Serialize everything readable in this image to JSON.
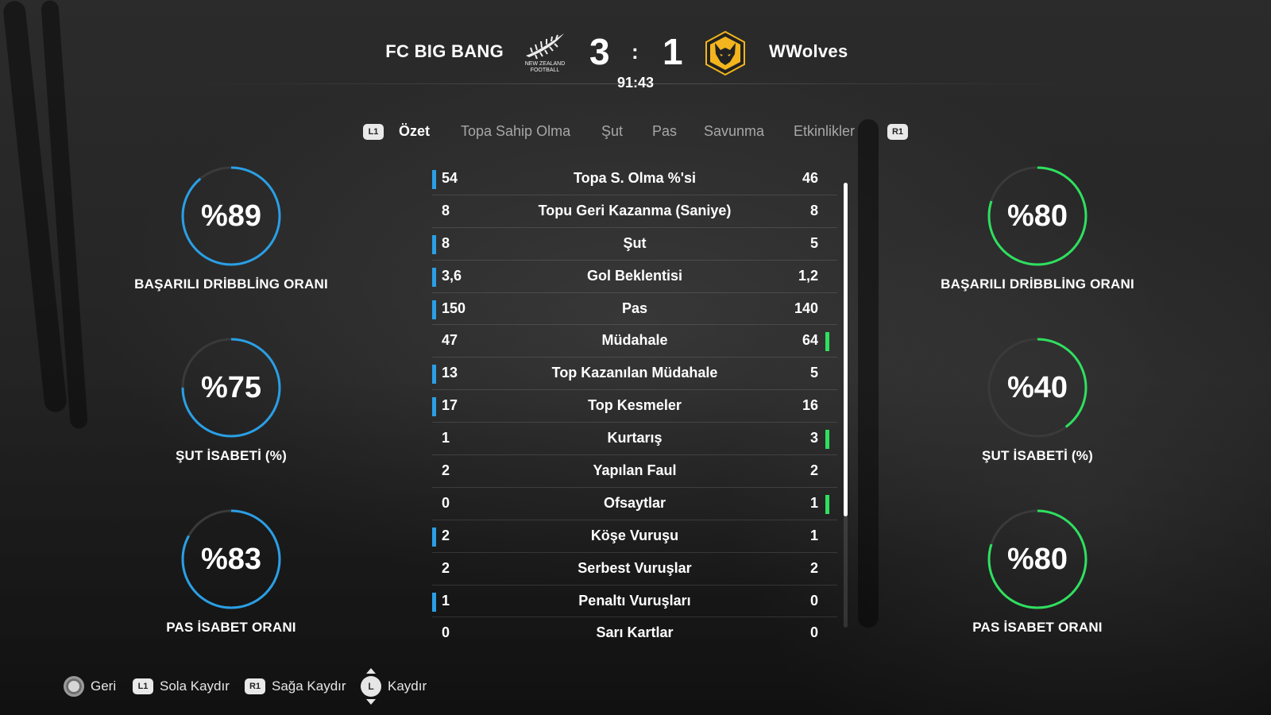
{
  "match": {
    "home_team": "FC BIG BANG",
    "away_team": "WWolves",
    "home_score": "3",
    "separator": ":",
    "away_score": "1",
    "clock": "91:43",
    "home_crest_text_1": "NEW ZEALAND",
    "home_crest_text_2": "FOOTBALL",
    "home_color": "#2a9fe6",
    "away_color": "#2fe05f"
  },
  "tabs": {
    "left_button": "L1",
    "right_button": "R1",
    "items": [
      {
        "label": "Özet",
        "active": true
      },
      {
        "label": "Topa Sahip Olma",
        "active": false
      },
      {
        "label": "Şut",
        "active": false
      },
      {
        "label": "Pas",
        "active": false
      },
      {
        "label": "Savunma",
        "active": false
      },
      {
        "label": "Etkinlikler",
        "active": false
      }
    ]
  },
  "gauges": {
    "home": [
      {
        "value": "%89",
        "percent": 89,
        "label": "BAŞARILI DRİBBLİNG ORANI"
      },
      {
        "value": "%75",
        "percent": 75,
        "label": "ŞUT İSABETİ (%)"
      },
      {
        "value": "%83",
        "percent": 83,
        "label": "PAS İSABET ORANI"
      }
    ],
    "away": [
      {
        "value": "%80",
        "percent": 80,
        "label": "BAŞARILI DRİBBLİNG ORANI"
      },
      {
        "value": "%40",
        "percent": 40,
        "label": "ŞUT İSABETİ (%)"
      },
      {
        "value": "%80",
        "percent": 80,
        "label": "PAS İSABET ORANI"
      }
    ]
  },
  "stats": [
    {
      "home": "54",
      "name": "Topa S. Olma %'si",
      "away": "46",
      "leader": "home"
    },
    {
      "home": "8",
      "name": "Topu Geri Kazanma (Saniye)",
      "away": "8",
      "leader": "none"
    },
    {
      "home": "8",
      "name": "Şut",
      "away": "5",
      "leader": "home"
    },
    {
      "home": "3,6",
      "name": "Gol Beklentisi",
      "away": "1,2",
      "leader": "home"
    },
    {
      "home": "150",
      "name": "Pas",
      "away": "140",
      "leader": "home"
    },
    {
      "home": "47",
      "name": "Müdahale",
      "away": "64",
      "leader": "away"
    },
    {
      "home": "13",
      "name": "Top Kazanılan Müdahale",
      "away": "5",
      "leader": "home"
    },
    {
      "home": "17",
      "name": "Top Kesmeler",
      "away": "16",
      "leader": "home"
    },
    {
      "home": "1",
      "name": "Kurtarış",
      "away": "3",
      "leader": "away"
    },
    {
      "home": "2",
      "name": "Yapılan Faul",
      "away": "2",
      "leader": "none"
    },
    {
      "home": "0",
      "name": "Ofsaytlar",
      "away": "1",
      "leader": "away"
    },
    {
      "home": "2",
      "name": "Köşe Vuruşu",
      "away": "1",
      "leader": "home"
    },
    {
      "home": "2",
      "name": "Serbest Vuruşlar",
      "away": "2",
      "leader": "none"
    },
    {
      "home": "1",
      "name": "Penaltı Vuruşları",
      "away": "0",
      "leader": "home"
    },
    {
      "home": "0",
      "name": "Sarı Kartlar",
      "away": "0",
      "leader": "none"
    }
  ],
  "footer": {
    "back": "Geri",
    "scroll_left_button": "L1",
    "scroll_left": "Sola Kaydır",
    "scroll_right_button": "R1",
    "scroll_right": "Sağa Kaydır",
    "scroll_button": "L",
    "scroll": "Kaydır"
  }
}
